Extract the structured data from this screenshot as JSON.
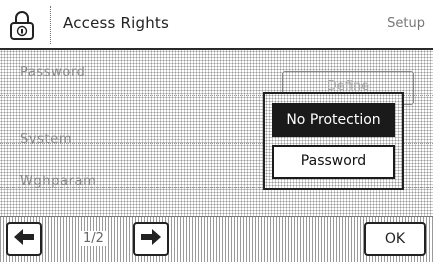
{
  "header": {
    "icon": "lock-icon",
    "title": "Access Rights",
    "mode": "Setup"
  },
  "rows": [
    {
      "label": "Password",
      "value": "Define"
    },
    {
      "label": "System"
    },
    {
      "label": "Wghparam"
    }
  ],
  "popup": {
    "options": [
      {
        "label": "No Protection",
        "selected": true
      },
      {
        "label": "Password",
        "selected": false
      }
    ]
  },
  "footer": {
    "prev_icon": "arrow-left-icon",
    "page_indicator": "1/2",
    "next_icon": "arrow-right-icon",
    "ok_label": "OK"
  }
}
